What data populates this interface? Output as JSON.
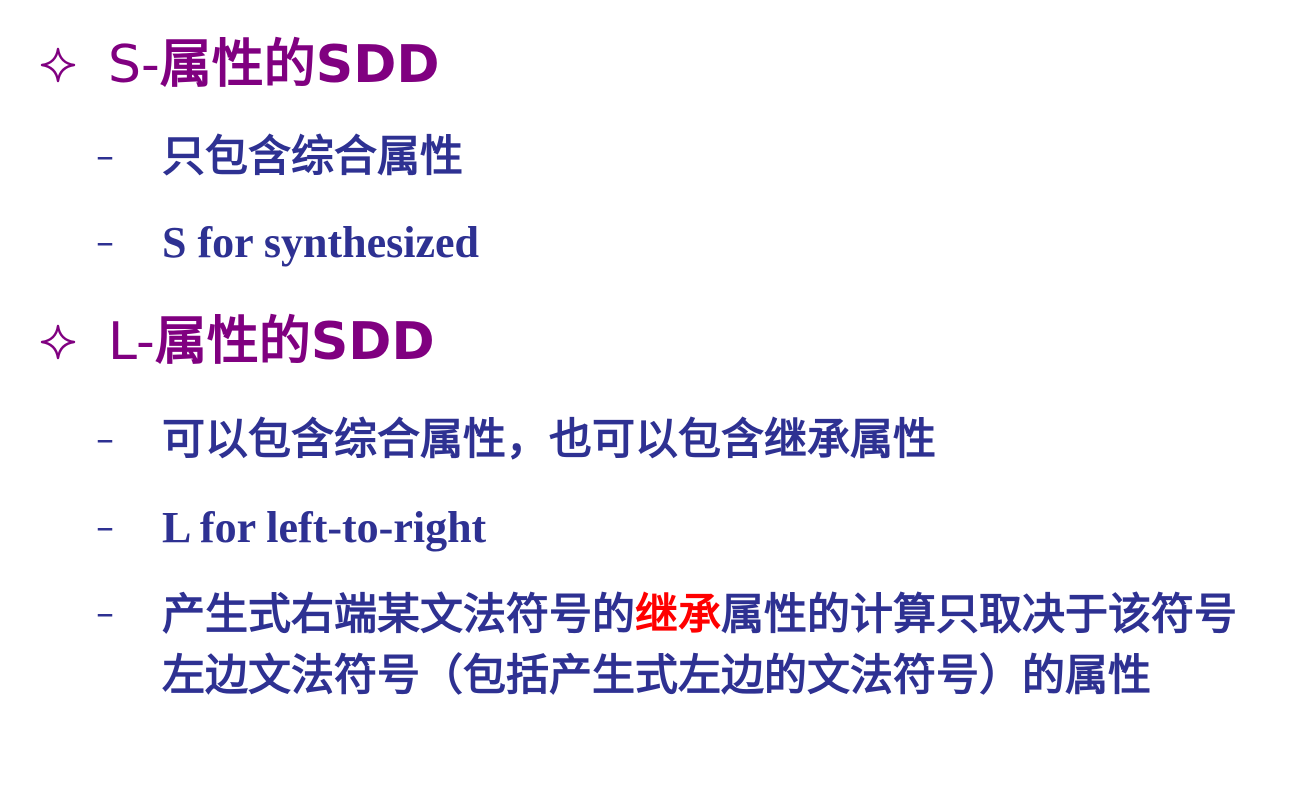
{
  "slide": {
    "items": [
      {
        "level": 1,
        "prefix": "S-",
        "bold": "属性的SDD"
      },
      {
        "level": 2,
        "text": "只包含综合属性"
      },
      {
        "level": 2,
        "text": "S for synthesized"
      },
      {
        "level": 1,
        "prefix": "L-",
        "bold": "属性的SDD"
      },
      {
        "level": 2,
        "text": "可以包含综合属性，也可以包含继承属性"
      },
      {
        "level": 2,
        "text": "L for left-to-right"
      },
      {
        "level": 2,
        "text_before": "产生式右端某文法符号的",
        "highlight": "继承",
        "text_after": "属性的计算只取决于该符号左边文法符号（包括产生式左边的文法符号）的属性"
      }
    ],
    "colors": {
      "level1": "#800080",
      "level2": "#2e3192",
      "highlight": "#ff0000"
    },
    "icons": {
      "level1_bullet": "four-point-star-icon",
      "level2_bullet": "dash-icon"
    }
  }
}
